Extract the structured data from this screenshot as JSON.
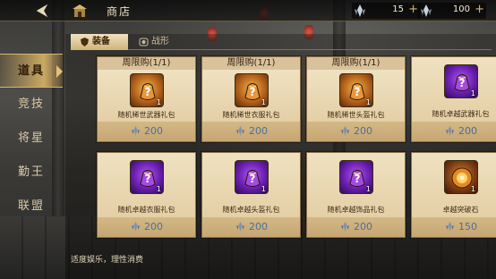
{
  "header": {
    "back_label": "⮜",
    "title": "商店"
  },
  "currencies": [
    {
      "icon": "crystal-icon",
      "value": "15"
    },
    {
      "icon": "crystal-icon",
      "value": "100"
    }
  ],
  "plus_label": "+",
  "nav": [
    {
      "label": "道具",
      "active": true
    },
    {
      "label": "竞技",
      "active": false
    },
    {
      "label": "将星",
      "active": false
    },
    {
      "label": "勤王",
      "active": false
    },
    {
      "label": "联盟",
      "active": false
    }
  ],
  "tabs": [
    {
      "label": "装备",
      "active": true
    },
    {
      "label": "战形",
      "active": false
    }
  ],
  "items": [
    {
      "limit": "周限购(1/1)",
      "name": "随机稀世武器礼包",
      "qty": "1",
      "price": "200",
      "rarity": "gold",
      "icon": "mystery-bag-icon"
    },
    {
      "limit": "周限购(1/1)",
      "name": "随机稀世衣服礼包",
      "qty": "1",
      "price": "200",
      "rarity": "gold",
      "icon": "mystery-bag-icon"
    },
    {
      "limit": "周限购(1/1)",
      "name": "随机稀世头盔礼包",
      "qty": "1",
      "price": "200",
      "rarity": "gold",
      "icon": "mystery-bag-icon"
    },
    {
      "limit": "",
      "name": "随机卓越武器礼包",
      "qty": "1",
      "price": "200",
      "rarity": "purple",
      "icon": "mystery-bag-icon"
    },
    {
      "limit": "",
      "name": "随机卓越衣服礼包",
      "qty": "1",
      "price": "200",
      "rarity": "purple",
      "icon": "mystery-bag-icon"
    },
    {
      "limit": "",
      "name": "随机卓越头盔礼包",
      "qty": "1",
      "price": "200",
      "rarity": "purple",
      "icon": "mystery-bag-icon"
    },
    {
      "limit": "",
      "name": "随机卓越饰品礼包",
      "qty": "1",
      "price": "200",
      "rarity": "purple",
      "icon": "mystery-bag-icon"
    },
    {
      "limit": "",
      "name": "卓越突破石",
      "qty": "1",
      "price": "150",
      "rarity": "orange",
      "icon": "breakthrough-stone-icon"
    }
  ],
  "notice": "适度娱乐，理性消费",
  "colors": {
    "accent_gold": "#d9b56b",
    "price_blue": "#4a6f9e",
    "rarity_gold": "#b5621b",
    "rarity_purple": "#6a1fb0"
  }
}
